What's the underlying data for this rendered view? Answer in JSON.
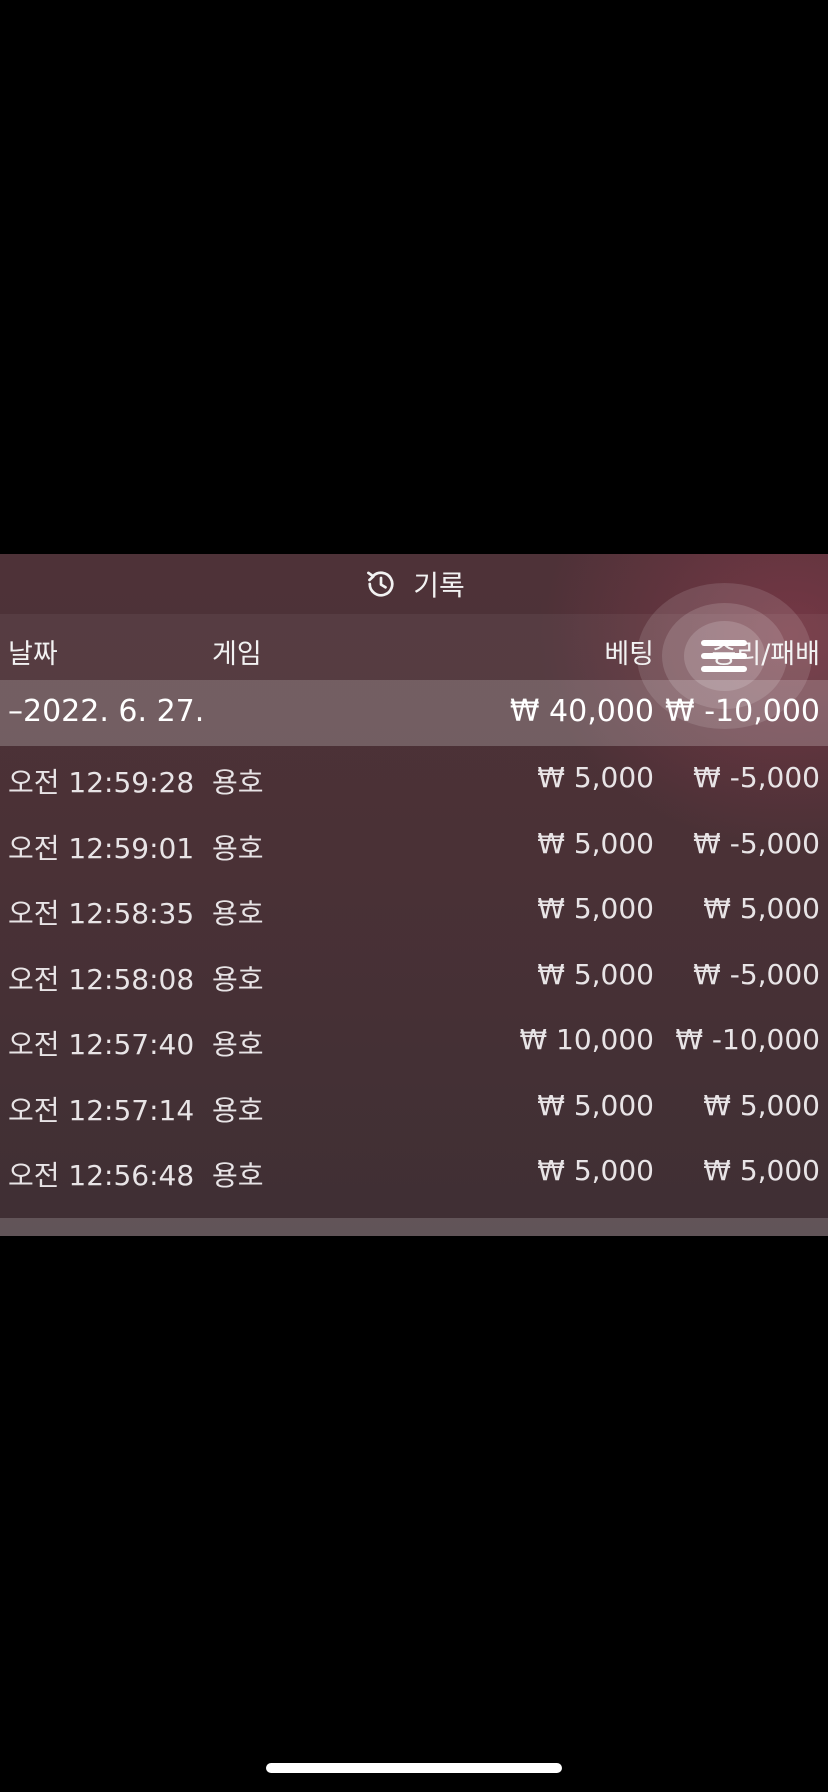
{
  "panel": {
    "title": "기록",
    "title_icon": "history-icon"
  },
  "columns": {
    "date": "날짜",
    "game": "게임",
    "bet": "베팅",
    "win_loss": "승리/패배"
  },
  "summary": {
    "date": "–2022. 6. 27.",
    "bet": "₩ 40,000",
    "win_loss": "₩ -10,000"
  },
  "rows": [
    {
      "time": "오전 12:59:28",
      "game": "용호",
      "bet": "₩ 5,000",
      "result": "₩ -5,000"
    },
    {
      "time": "오전 12:59:01",
      "game": "용호",
      "bet": "₩ 5,000",
      "result": "₩ -5,000"
    },
    {
      "time": "오전 12:58:35",
      "game": "용호",
      "bet": "₩ 5,000",
      "result": "₩ 5,000"
    },
    {
      "time": "오전 12:58:08",
      "game": "용호",
      "bet": "₩ 5,000",
      "result": "₩ -5,000"
    },
    {
      "time": "오전 12:57:40",
      "game": "용호",
      "bet": "₩ 10,000",
      "result": "₩ -10,000"
    },
    {
      "time": "오전 12:57:14",
      "game": "용호",
      "bet": "₩ 5,000",
      "result": "₩ 5,000"
    },
    {
      "time": "오전 12:56:48",
      "game": "용호",
      "bet": "₩ 5,000",
      "result": "₩ 5,000"
    }
  ],
  "menu": {
    "icon": "hamburger-menu-icon"
  }
}
